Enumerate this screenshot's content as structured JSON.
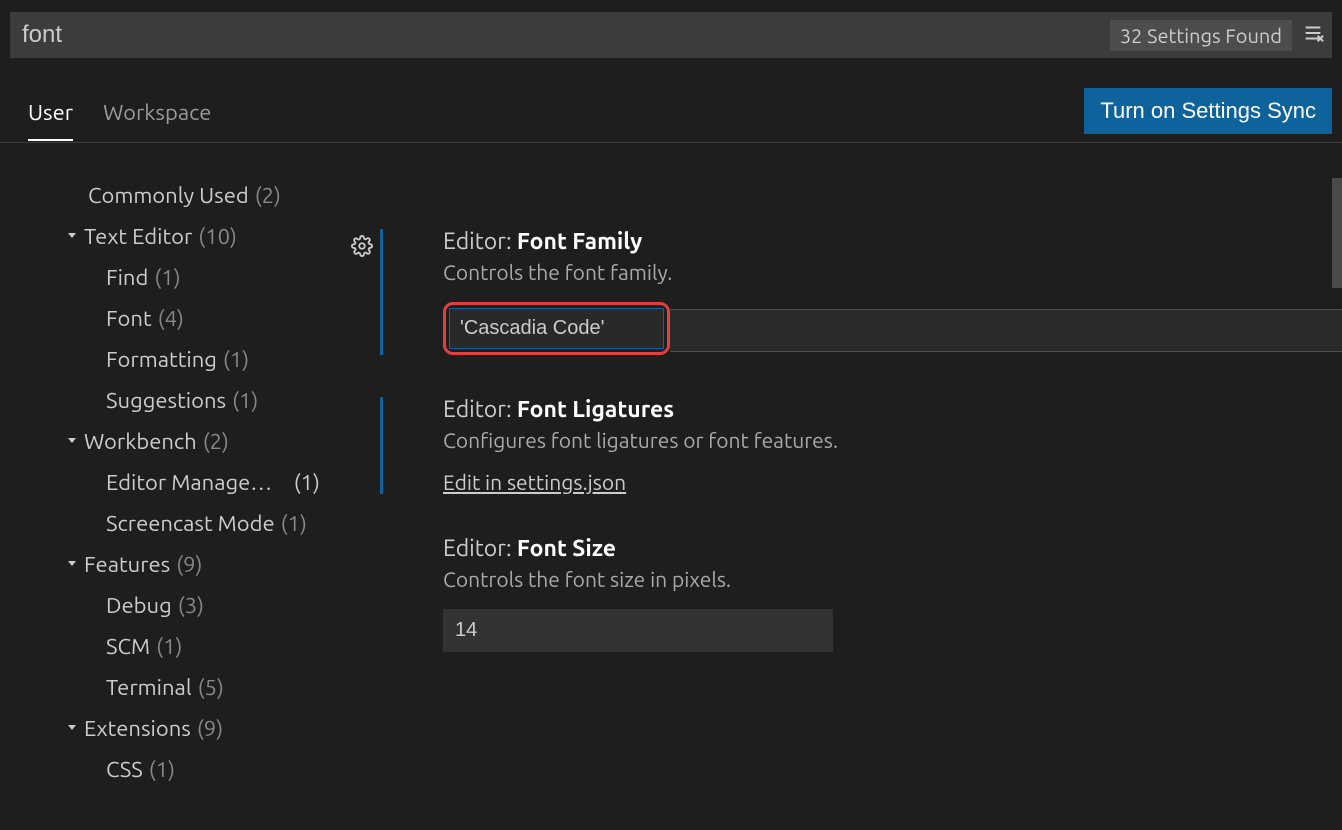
{
  "search": {
    "value": "font",
    "results_label": "32 Settings Found"
  },
  "tabs": {
    "user": "User",
    "workspace": "Workspace"
  },
  "sync_button": "Turn on Settings Sync",
  "sidebar": {
    "commonly_used": {
      "label": "Commonly Used",
      "count": "(2)"
    },
    "text_editor": {
      "label": "Text Editor",
      "count": "(10)"
    },
    "find": {
      "label": "Find",
      "count": "(1)"
    },
    "font": {
      "label": "Font",
      "count": "(4)"
    },
    "formatting": {
      "label": "Formatting",
      "count": "(1)"
    },
    "suggestions": {
      "label": "Suggestions",
      "count": "(1)"
    },
    "workbench": {
      "label": "Workbench",
      "count": "(2)"
    },
    "editor_mgmt": {
      "label": "Editor Manage…",
      "count": "(1)"
    },
    "screencast": {
      "label": "Screencast Mode",
      "count": "(1)"
    },
    "features": {
      "label": "Features",
      "count": "(9)"
    },
    "debug": {
      "label": "Debug",
      "count": "(3)"
    },
    "scm": {
      "label": "SCM",
      "count": "(1)"
    },
    "terminal": {
      "label": "Terminal",
      "count": "(5)"
    },
    "extensions": {
      "label": "Extensions",
      "count": "(9)"
    },
    "css": {
      "label": "CSS",
      "count": "(1)"
    }
  },
  "settings": {
    "font_family": {
      "prefix": "Editor:",
      "name": "Font Family",
      "desc": "Controls the font family.",
      "value": "'Cascadia Code'"
    },
    "font_ligatures": {
      "prefix": "Editor:",
      "name": "Font Ligatures",
      "desc": "Configures font ligatures or font features.",
      "edit_link": "Edit in settings.json"
    },
    "font_size": {
      "prefix": "Editor:",
      "name": "Font Size",
      "desc": "Controls the font size in pixels.",
      "value": "14"
    }
  }
}
